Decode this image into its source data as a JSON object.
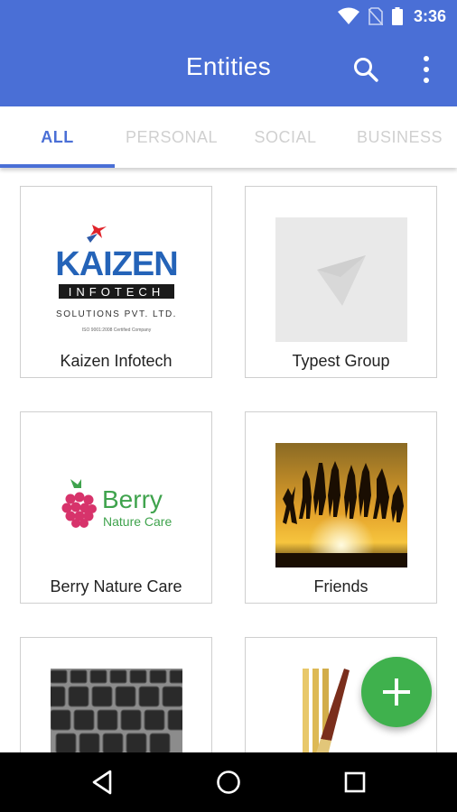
{
  "status_bar": {
    "time": "3:36",
    "icons": [
      "wifi-icon",
      "no-sim-icon",
      "battery-icon"
    ]
  },
  "app_bar": {
    "title": "Entities",
    "actions": [
      "search-icon",
      "more-vert-icon"
    ],
    "color": "#4a6fd6"
  },
  "tabs": [
    {
      "label": "ALL",
      "active": true
    },
    {
      "label": "PERSONAL",
      "active": false
    },
    {
      "label": "SOCIAL",
      "active": false
    },
    {
      "label": "BUSINESS",
      "active": false
    }
  ],
  "entities": [
    {
      "name": "Kaizen Infotech",
      "logo_text": [
        "KAIZEN",
        "INFOTECH",
        "SOLUTIONS PVT. LTD.",
        "ISO 9001:2008 Certified Company"
      ]
    },
    {
      "name": "Typest Group",
      "logo_text": []
    },
    {
      "name": "Berry Nature Care",
      "logo_text": [
        "Berry",
        "Nature Care"
      ]
    },
    {
      "name": "Friends",
      "logo_text": []
    },
    {
      "name": "",
      "logo_text": []
    },
    {
      "name": "",
      "logo_text": []
    }
  ],
  "fab": {
    "icon": "plus-icon",
    "color": "#3fb14d"
  },
  "nav_bar": {
    "buttons": [
      "back-icon",
      "home-icon",
      "recents-icon"
    ]
  }
}
